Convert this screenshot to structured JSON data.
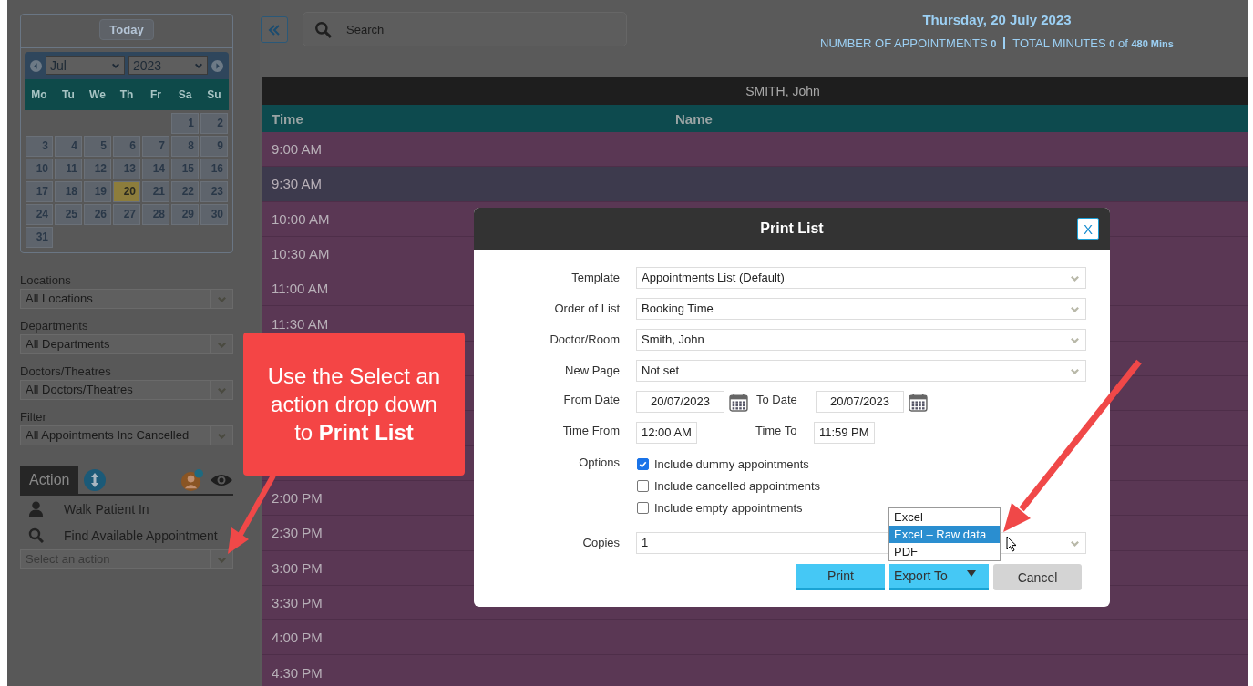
{
  "sidebar": {
    "today_button": "Today",
    "calendar": {
      "month": "Jul",
      "year": "2023",
      "weekdays": [
        "Mo",
        "Tu",
        "We",
        "Th",
        "Fr",
        "Sa",
        "Su"
      ],
      "weeks": [
        [
          {
            "kind": "blank"
          },
          {
            "kind": "blank"
          },
          {
            "kind": "blank"
          },
          {
            "kind": "blank"
          },
          {
            "kind": "blank"
          },
          {
            "day": "1",
            "selected": false
          },
          {
            "day": "2",
            "selected": false
          }
        ],
        [
          {
            "day": "3",
            "selected": false
          },
          {
            "day": "4",
            "selected": false
          },
          {
            "day": "5",
            "selected": false
          },
          {
            "day": "6",
            "selected": false
          },
          {
            "day": "7",
            "selected": false
          },
          {
            "day": "8",
            "selected": false
          },
          {
            "day": "9",
            "selected": false
          }
        ],
        [
          {
            "day": "10",
            "selected": false
          },
          {
            "day": "11",
            "selected": false
          },
          {
            "day": "12",
            "selected": false
          },
          {
            "day": "13",
            "selected": false
          },
          {
            "day": "14",
            "selected": false
          },
          {
            "day": "15",
            "selected": false
          },
          {
            "day": "16",
            "selected": false
          }
        ],
        [
          {
            "day": "17",
            "selected": false
          },
          {
            "day": "18",
            "selected": false
          },
          {
            "day": "19",
            "selected": false
          },
          {
            "day": "20",
            "selected": true
          },
          {
            "day": "21",
            "selected": false
          },
          {
            "day": "22",
            "selected": false
          },
          {
            "day": "23",
            "selected": false
          }
        ],
        [
          {
            "day": "24",
            "selected": false
          },
          {
            "day": "25",
            "selected": false
          },
          {
            "day": "26",
            "selected": false
          },
          {
            "day": "27",
            "selected": false
          },
          {
            "day": "28",
            "selected": false
          },
          {
            "day": "29",
            "selected": false
          },
          {
            "day": "30",
            "selected": false
          }
        ],
        [
          {
            "day": "31",
            "selected": false
          },
          {
            "kind": "blank"
          },
          {
            "kind": "blank"
          },
          {
            "kind": "blank"
          },
          {
            "kind": "blank"
          },
          {
            "kind": "blank"
          },
          {
            "kind": "blank"
          }
        ]
      ]
    },
    "filters": [
      {
        "label": "Locations",
        "value": "All Locations"
      },
      {
        "label": "Departments",
        "value": "All Departments"
      },
      {
        "label": "Doctors/Theatres",
        "value": "All Doctors/Theatres"
      },
      {
        "label": "Filter",
        "value": "All Appointments Inc Cancelled"
      }
    ],
    "action_panel": {
      "tab": "Action",
      "items": [
        {
          "kind": "person",
          "label": "Walk Patient In"
        },
        {
          "kind": "search",
          "label": "Find Available Appointment"
        }
      ],
      "select": {
        "placeholder": "Select an action"
      }
    }
  },
  "toolbar": {
    "search": {
      "placeholder": "Search"
    },
    "date": "Thursday, 20 July 2023",
    "stats": [
      "NUMBER OF APPOINTMENTS **0**",
      "TOTAL MINUTES **0** of **480 Mins**"
    ]
  },
  "schedule": {
    "doctor": "SMITH, John",
    "columns": [
      "Time",
      "Name"
    ],
    "rows": [
      {
        "time": "9:00 AM",
        "selected": false
      },
      {
        "time": "9:30 AM",
        "selected": true
      },
      {
        "time": "10:00 AM",
        "selected": false
      },
      {
        "time": "10:30 AM",
        "selected": false
      },
      {
        "time": "11:00 AM",
        "selected": false
      },
      {
        "time": "11:30 AM",
        "selected": false
      },
      {
        "selected": false
      },
      {
        "selected": false
      },
      {
        "selected": false
      },
      {
        "selected": false
      },
      {
        "time": "2:00 PM",
        "selected": false
      },
      {
        "time": "2:30 PM",
        "selected": false
      },
      {
        "time": "3:00 PM",
        "selected": false
      },
      {
        "time": "3:30 PM",
        "selected": false
      },
      {
        "time": "4:00 PM",
        "selected": false
      },
      {
        "time": "4:30 PM",
        "selected": false
      }
    ]
  },
  "dialog": {
    "title": "Print List",
    "close": "X",
    "fields": [
      {
        "kind": "select",
        "label": "Template",
        "value": "Appointments List (Default)"
      },
      {
        "kind": "select",
        "label": "Order of List",
        "value": "Booking Time"
      },
      {
        "kind": "select",
        "label": "Doctor/Room",
        "value": "Smith, John"
      },
      {
        "kind": "select",
        "label": "New Page",
        "value": "Not set"
      },
      {
        "kind": "range",
        "label": "From Date",
        "value": "20/07/2023",
        "label2": "To Date",
        "value2": "20/07/2023",
        "calendar": true
      },
      {
        "kind": "range",
        "label": "Time From",
        "value": "12:00 AM",
        "label2": "Time To",
        "value2": "11:59 PM",
        "calendar": false
      },
      {
        "kind": "checks",
        "label": "Options",
        "options": [
          {
            "label": "Include dummy appointments",
            "checked": true
          },
          {
            "label": "Include cancelled appointments",
            "checked": false
          },
          {
            "label": "Include empty appointments",
            "checked": false
          }
        ]
      },
      {
        "kind": "select",
        "label": "Copies",
        "value": "1"
      }
    ],
    "buttons": [
      {
        "kind": "primary",
        "label": "Print"
      },
      {
        "kind": "dropdown",
        "label": "Export To"
      },
      {
        "kind": "secondary",
        "label": "Cancel"
      }
    ],
    "export_menu": [
      {
        "label": "Excel",
        "selected": false
      },
      {
        "label": "Excel – Raw data",
        "selected": true
      },
      {
        "label": "PDF",
        "selected": false
      }
    ]
  },
  "callout": {
    "text": "Use the Select an action drop down to **Print List**"
  }
}
